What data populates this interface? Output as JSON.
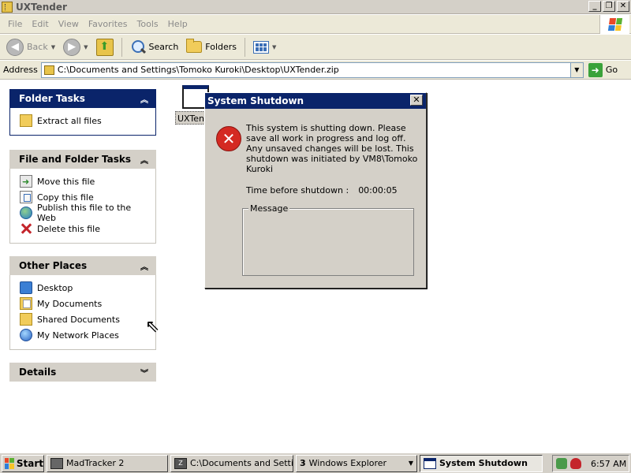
{
  "window": {
    "title": "UXTender",
    "controls": {
      "minimize": "_",
      "maximize": "❐",
      "close": "✕"
    }
  },
  "menubar": {
    "items": [
      "File",
      "Edit",
      "View",
      "Favorites",
      "Tools",
      "Help"
    ]
  },
  "toolbar": {
    "back_label": "Back",
    "search_label": "Search",
    "folders_label": "Folders"
  },
  "addressbar": {
    "label": "Address",
    "value": "C:\\Documents and Settings\\Tomoko Kuroki\\Desktop\\UXTender.zip",
    "go_label": "Go"
  },
  "sidebar": {
    "folder_tasks": {
      "title": "Folder Tasks",
      "items": [
        "Extract all files"
      ]
    },
    "file_folder_tasks": {
      "title": "File and Folder Tasks",
      "items": [
        "Move this file",
        "Copy this file",
        "Publish this file to the Web",
        "Delete this file"
      ]
    },
    "other_places": {
      "title": "Other Places",
      "items": [
        "Desktop",
        "My Documents",
        "Shared Documents",
        "My Network Places"
      ]
    },
    "details": {
      "title": "Details"
    }
  },
  "content": {
    "file_label": "UXTender"
  },
  "dialog": {
    "title": "System Shutdown",
    "close": "✕",
    "message": "This system is shutting down. Please save all work in progress and log off. Any unsaved changes will be lost. This shutdown was initiated by VM8\\Tomoko Kuroki",
    "timer_label": "Time before shutdown :",
    "timer_value": "00:00:05",
    "message_group_label": "Message"
  },
  "taskbar": {
    "start_label": "Start",
    "buttons": {
      "madtracker": "MadTracker 2",
      "explorer_path": "C:\\Documents and Setti...",
      "explorer_group_count": "3",
      "explorer_group_label": "Windows Explorer",
      "shutdown": "System Shutdown"
    },
    "clock": "6:57 AM"
  }
}
